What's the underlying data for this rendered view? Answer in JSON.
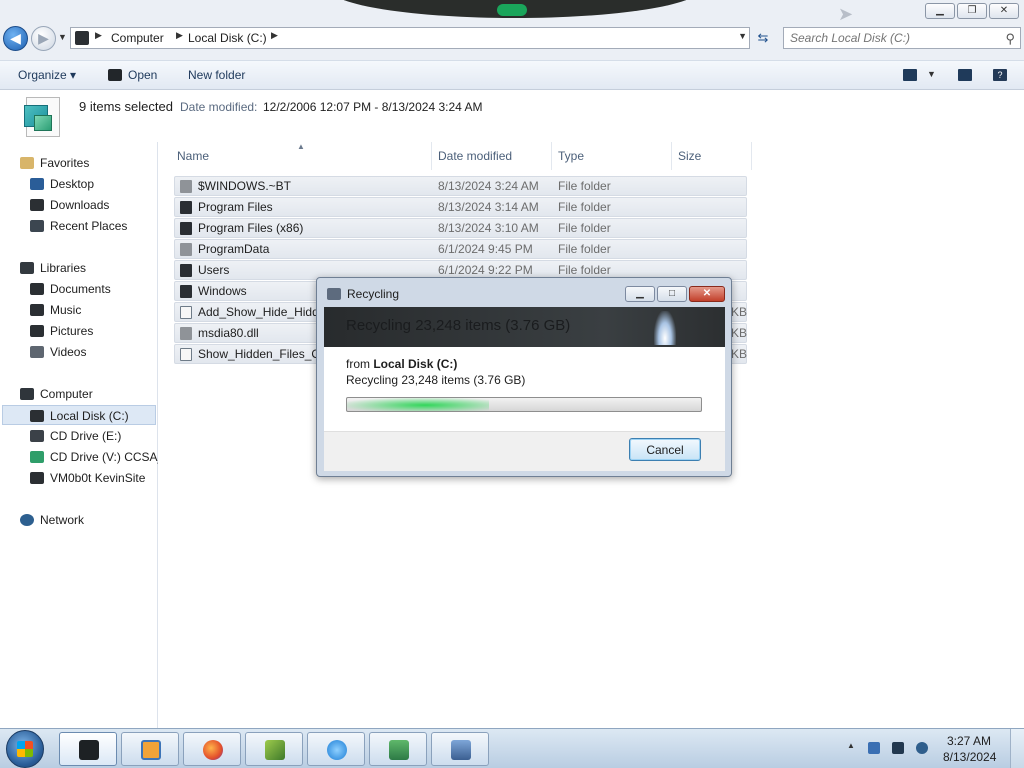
{
  "window": {
    "minimize_glyph": "▁",
    "maximize_glyph": "❐",
    "close_glyph": "✕"
  },
  "address": {
    "crumbs": [
      "Computer",
      "Local Disk (C:)"
    ],
    "refresh_glyph": "⇆"
  },
  "search": {
    "placeholder": "Search Local Disk (C:)",
    "icon": "search-icon"
  },
  "toolbar": {
    "organize_label": "Organize ▾",
    "open_label": "Open",
    "new_folder_label": "New folder",
    "help_glyph": "?"
  },
  "details": {
    "selection_text": "9 items selected",
    "date_label": "Date modified:",
    "date_value": "12/2/2006 12:07 PM - 8/13/2024 3:24 AM"
  },
  "nav": {
    "favorites_header": "Favorites",
    "favorites": [
      "Desktop",
      "Downloads",
      "Recent Places"
    ],
    "libraries_header": "Libraries",
    "libraries": [
      "Documents",
      "Music",
      "Pictures",
      "Videos"
    ],
    "computer_header": "Computer",
    "computer": [
      "Local Disk (C:)",
      "CD Drive (E:)",
      "CD Drive (V:) CCSA_",
      "VM0b0t KevinSite"
    ],
    "network_header": "Network"
  },
  "columns": {
    "name": "Name",
    "date_modified": "Date modified",
    "type": "Type",
    "size": "Size",
    "sort_arrow": "▲"
  },
  "files": [
    {
      "name": "$WINDOWS.~BT",
      "date": "8/13/2024 3:24 AM",
      "type": "File folder",
      "size": ""
    },
    {
      "name": "Program Files",
      "date": "8/13/2024 3:14 AM",
      "type": "File folder",
      "size": ""
    },
    {
      "name": "Program Files (x86)",
      "date": "8/13/2024 3:10 AM",
      "type": "File folder",
      "size": ""
    },
    {
      "name": "ProgramData",
      "date": "6/1/2024 9:45 PM",
      "type": "File folder",
      "size": ""
    },
    {
      "name": "Users",
      "date": "6/1/2024 9:22 PM",
      "type": "File folder",
      "size": ""
    },
    {
      "name": "Windows",
      "date": "",
      "type": "",
      "size": ""
    },
    {
      "name": "Add_Show_Hide_Hidd",
      "date": "",
      "type": "",
      "size": "KB"
    },
    {
      "name": "msdia80.dll",
      "date": "",
      "type": "",
      "size": "KB"
    },
    {
      "name": "Show_Hidden_Files_On",
      "date": "",
      "type": "",
      "size": "KB"
    }
  ],
  "dialog": {
    "title": "Recycling",
    "banner_text": "Recycling 23,248 items (3.76 GB)",
    "from_prefix": "from ",
    "from_location": "Local Disk (C:)",
    "status": "Recycling 23,248 items (3.76 GB)",
    "progress_fraction": 0.4,
    "cancel_label": "Cancel",
    "minimize_glyph": "▁",
    "maximize_glyph": "□",
    "close_glyph": "✕"
  },
  "taskbar": {
    "time": "3:27 AM",
    "date": "8/13/2024",
    "tray_up_glyph": "▲",
    "tasks": [
      "explorer-icon",
      "media-player-icon",
      "firefox-icon",
      "app-cube-icon",
      "internet-explorer-icon",
      "chart-app-icon",
      "remote-desktop-icon"
    ]
  },
  "colors": {
    "accent": "#1e395b",
    "selection": "#dde8f5",
    "progress_green": "#31d65a"
  }
}
